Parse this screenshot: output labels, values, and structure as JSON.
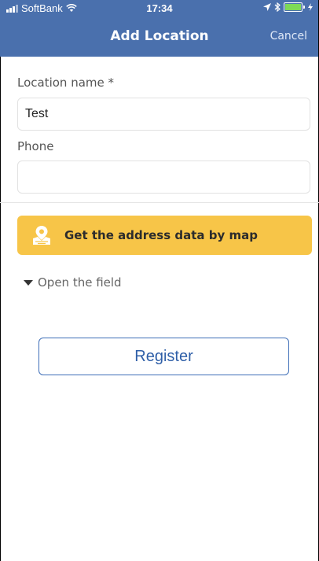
{
  "status_bar": {
    "carrier": "SoftBank",
    "time": "17:34"
  },
  "header": {
    "title": "Add Location",
    "cancel_label": "Cancel",
    "background_color": "#4a70ad"
  },
  "form": {
    "location_name": {
      "label": "Location name *",
      "value": "Test"
    },
    "phone": {
      "label": "Phone",
      "value": ""
    }
  },
  "map_button": {
    "label": "Get the address data by map",
    "icon": "map-pin-icon",
    "background_color": "#f7c548"
  },
  "expander": {
    "label": "Open the field",
    "icon": "caret-down-icon"
  },
  "register_button": {
    "label": "Register",
    "accent_color": "#3e6eb7"
  }
}
